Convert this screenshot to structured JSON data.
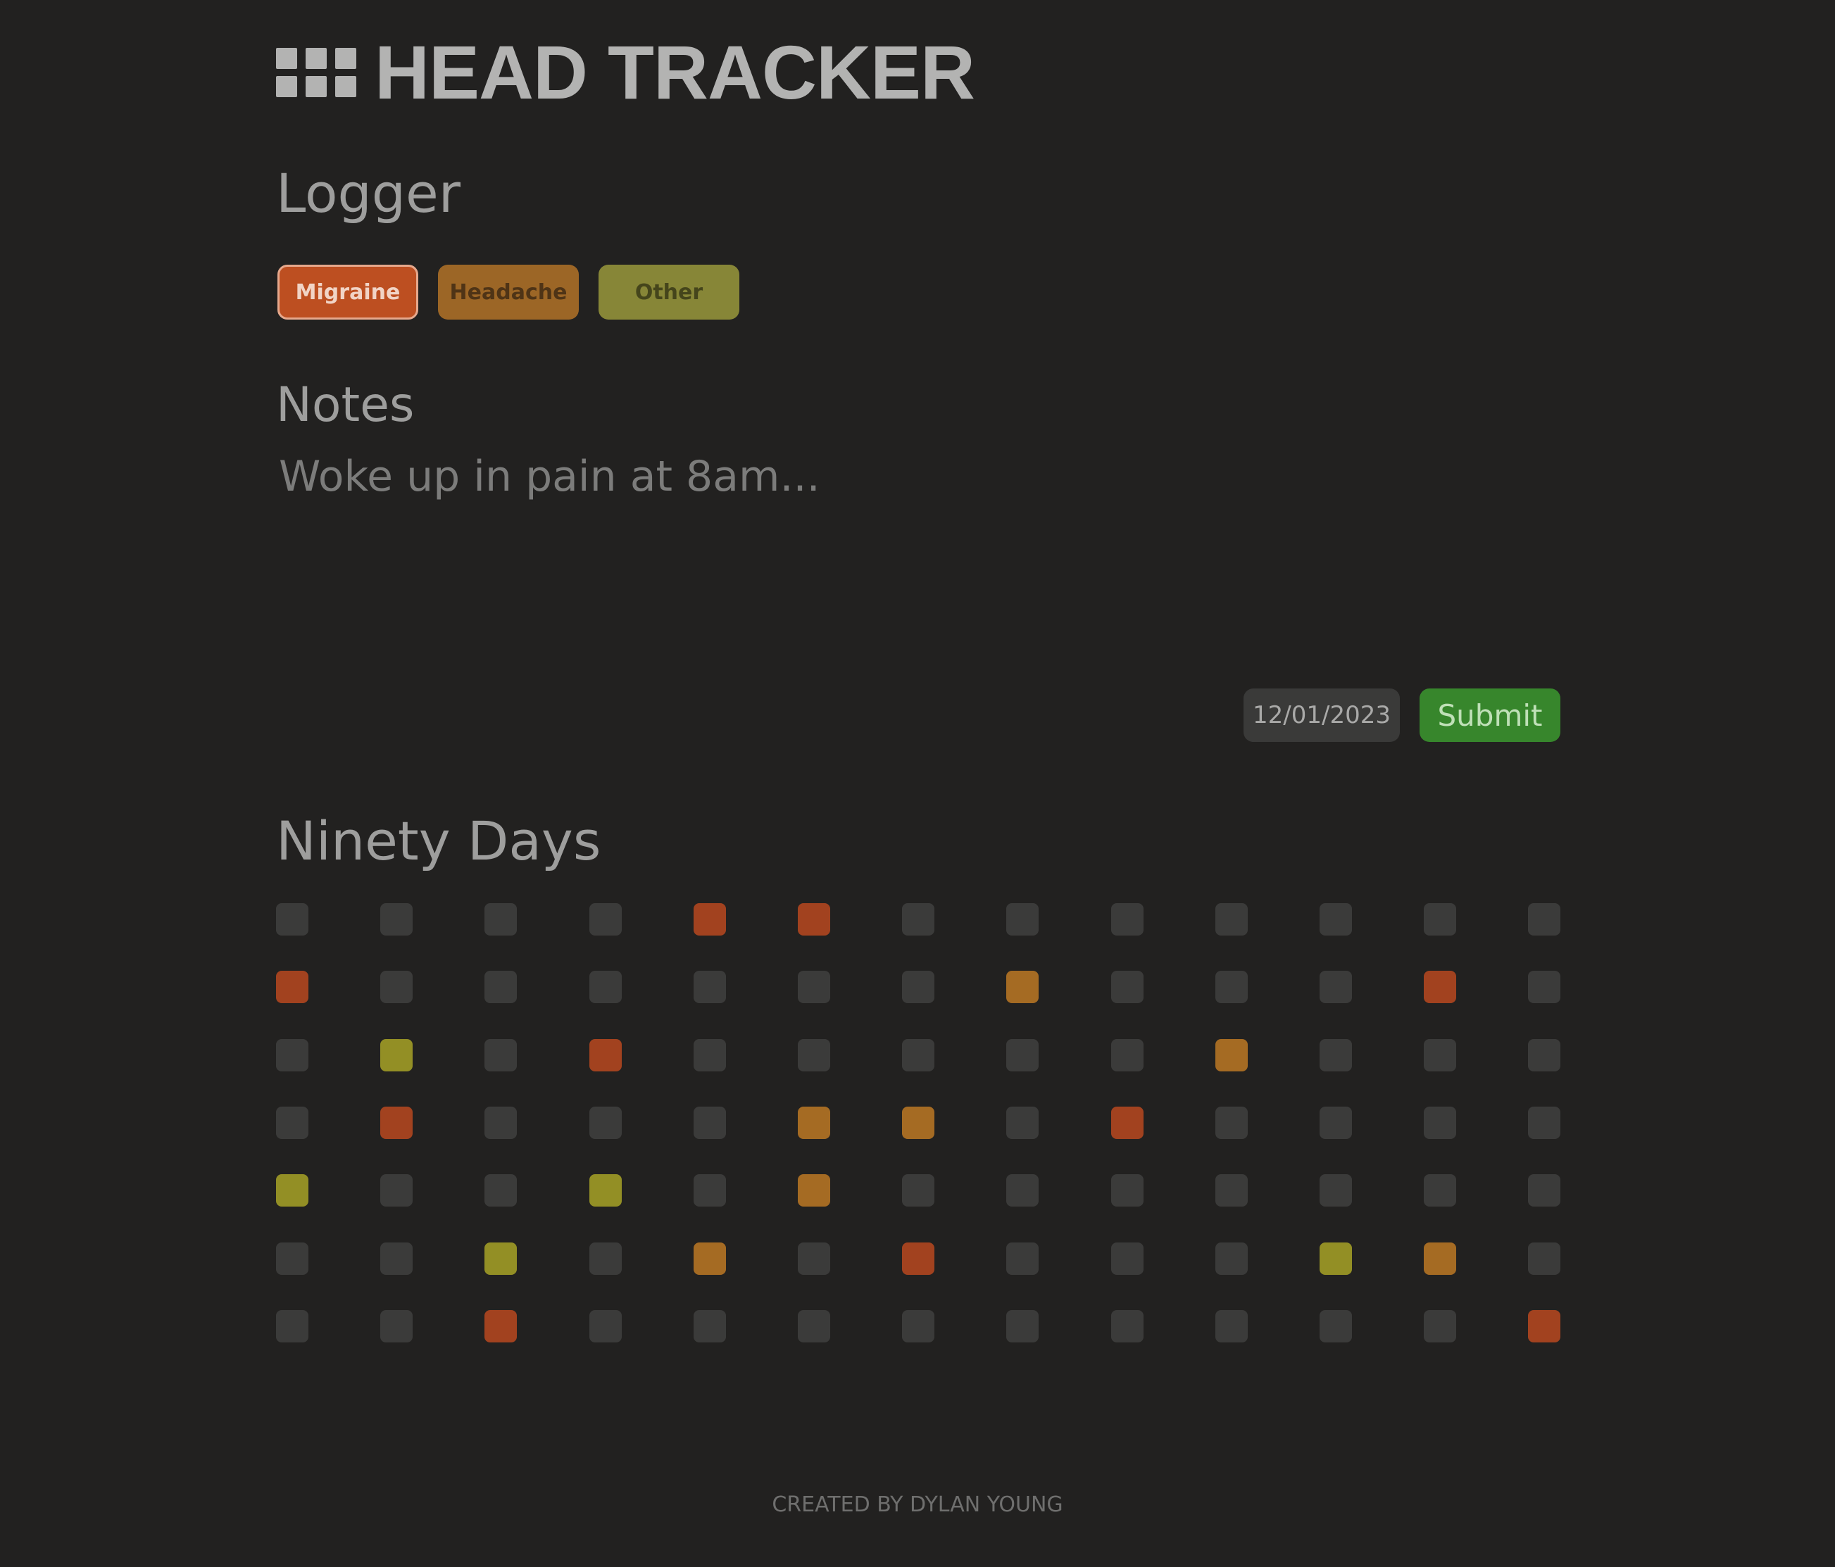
{
  "app": {
    "title": "HEAD TRACKER",
    "logo_icon": "grid-dots-icon"
  },
  "logger": {
    "heading": "Logger",
    "types": [
      {
        "label": "Migraine",
        "selected": true,
        "color": "#bd4f21"
      },
      {
        "label": "Headache",
        "selected": false,
        "color": "#9c6626"
      },
      {
        "label": "Other",
        "selected": false,
        "color": "#878637"
      }
    ]
  },
  "notes": {
    "heading": "Notes",
    "placeholder": "Woke up in pain at 8am...",
    "value": ""
  },
  "form": {
    "date": "12/01/2023",
    "submit_label": "Submit"
  },
  "ninety_days": {
    "heading": "Ninety Days",
    "legend_colors": {
      "none": "#3b3b3a",
      "migraine": "#a2421f",
      "headache": "#a56b23",
      "other": "#938f25"
    },
    "rows": [
      [
        "none",
        "none",
        "none",
        "none",
        "migraine",
        "migraine",
        "none",
        "none",
        "none",
        "none",
        "none",
        "none",
        "none"
      ],
      [
        "migraine",
        "none",
        "none",
        "none",
        "none",
        "none",
        "none",
        "headache",
        "none",
        "none",
        "none",
        "migraine",
        "none"
      ],
      [
        "none",
        "other",
        "none",
        "migraine",
        "none",
        "none",
        "none",
        "none",
        "none",
        "headache",
        "none",
        "none",
        "none"
      ],
      [
        "none",
        "migraine",
        "none",
        "none",
        "none",
        "headache",
        "headache",
        "none",
        "migraine",
        "none",
        "none",
        "none",
        "none"
      ],
      [
        "other",
        "none",
        "none",
        "other",
        "none",
        "headache",
        "none",
        "none",
        "none",
        "none",
        "none",
        "none",
        "none"
      ],
      [
        "none",
        "none",
        "other",
        "none",
        "headache",
        "none",
        "migraine",
        "none",
        "none",
        "none",
        "other",
        "headache",
        "none"
      ],
      [
        "none",
        "none",
        "migraine",
        "none",
        "none",
        "none",
        "none",
        "none",
        "none",
        "none",
        "none",
        "none",
        "migraine"
      ]
    ]
  },
  "footer": {
    "credit": "CREATED BY DYLAN YOUNG"
  }
}
